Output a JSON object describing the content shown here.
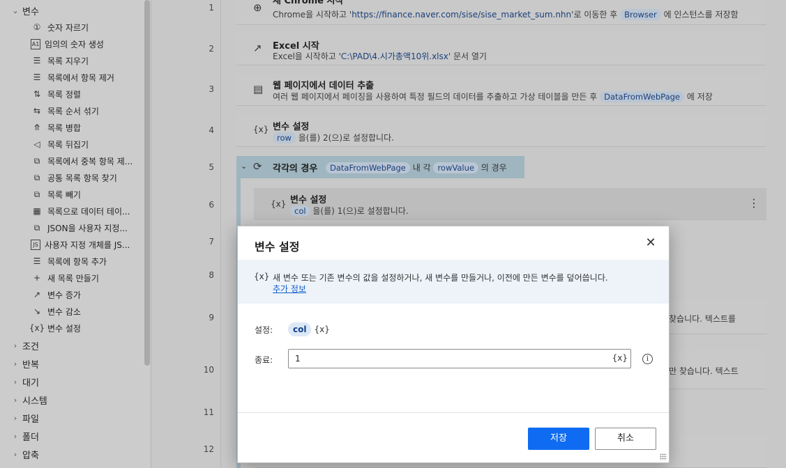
{
  "sidebar": {
    "variables_group": "변수",
    "items": [
      {
        "icon": "number-circle-icon",
        "glyph": "①",
        "label": "숫자 자르기"
      },
      {
        "icon": "random-number-icon",
        "glyph": "A1",
        "label": "임의의 숫자 생성"
      },
      {
        "icon": "clear-list-icon",
        "glyph": "☰",
        "label": "목록 지우기"
      },
      {
        "icon": "remove-list-item-icon",
        "glyph": "☰",
        "label": "목록에서 항목 제거"
      },
      {
        "icon": "sort-list-icon",
        "glyph": "⇅",
        "label": "목록 정렬"
      },
      {
        "icon": "shuffle-list-icon",
        "glyph": "⇆",
        "label": "목록 순서 섞기"
      },
      {
        "icon": "merge-list-icon",
        "glyph": "⤊",
        "label": "목록 병합"
      },
      {
        "icon": "reverse-list-icon",
        "glyph": "◁",
        "label": "목록 뒤집기"
      },
      {
        "icon": "remove-duplicates-icon",
        "glyph": "⧉",
        "label": "목록에서 중복 항목 제..."
      },
      {
        "icon": "common-items-icon",
        "glyph": "⧉",
        "label": "공통 목록 항목 찾기"
      },
      {
        "icon": "subtract-list-icon",
        "glyph": "⧉",
        "label": "목록 빼기"
      },
      {
        "icon": "list-to-datatable-icon",
        "glyph": "▦",
        "label": "목록으로 데이터 테이..."
      },
      {
        "icon": "json-to-object-icon",
        "glyph": "⧉",
        "label": "JSON을 사용자 지정..."
      },
      {
        "icon": "object-to-json-icon",
        "glyph": "JS",
        "label": "사용자 지정 개체를 JS..."
      },
      {
        "icon": "add-to-list-icon",
        "glyph": "☰",
        "label": "목록에 항목 추가"
      },
      {
        "icon": "new-list-icon",
        "glyph": "+",
        "label": "새 목록 만들기"
      },
      {
        "icon": "increase-variable-icon",
        "glyph": "↗",
        "label": "변수 증가"
      },
      {
        "icon": "decrease-variable-icon",
        "glyph": "↘",
        "label": "변수 감소"
      },
      {
        "icon": "set-variable-icon",
        "glyph": "{x}",
        "label": "변수 설정"
      }
    ],
    "groups": [
      "조건",
      "반복",
      "대기",
      "시스템",
      "파일",
      "폴더",
      "압축"
    ]
  },
  "flow": {
    "line_numbers": [
      "1",
      "2",
      "3",
      "4",
      "5",
      "6",
      "7",
      "8",
      "9",
      "10",
      "11",
      "12"
    ],
    "step1": {
      "title": "새 Chrome 시작",
      "desc_a": "Chrome을 시작하고 '",
      "url": "https://finance.naver.com/sise/sise_market_sum.nhn",
      "desc_b": "'로 이동한 후",
      "var": "Browser",
      "desc_c": "에 인스턴스를 저장함"
    },
    "step2": {
      "title": "Excel 시작",
      "desc_a": "Excel을 시작하고 '",
      "path": "C:\\PAD\\4.시가총액10위.xlsx",
      "desc_b": "' 문서 열기"
    },
    "step3": {
      "title": "웹 페이지에서 데이터 추출",
      "desc_a": "여러 웹 페이지에서 페이징을 사용하여 특정 필드의 데이터를 추출하고 가상 테이블을 만든 후",
      "var": "DataFromWebPage",
      "desc_b": "에 저장"
    },
    "step4": {
      "icon_text": "{x}",
      "title": "변수 설정",
      "var": "row",
      "desc_a": "을(를)",
      "value": "2",
      "desc_b": "(으)로 설정합니다."
    },
    "step5": {
      "title": "각각의 경우",
      "var1": "DataFromWebPage",
      "mid": "내 각",
      "var2": "rowValue",
      "end": "의 경우"
    },
    "step6": {
      "icon_text": "{x}",
      "title": "변수 설정",
      "var": "col",
      "desc_a": "을(를)",
      "value": "1",
      "desc_b": "(으)로 설정합니다.",
      "more": "⋮"
    },
    "step9_tail": "찾습니다. 텍스트를",
    "step10_tail": "만 찾습니다. 텍스트"
  },
  "dialog": {
    "title": "변수 설정",
    "close": "✕",
    "info_icon": "{x}",
    "info_text": "새 변수 또는 기존 변수의 값을 설정하거나, 새 변수를 만들거나, 이전에 만든 변수를 덮어씁니다.",
    "info_link": "추가 정보",
    "set_label": "설정:",
    "variable_name": "col",
    "variable_suffix": "{x}",
    "value_label": "종료:",
    "value": "1",
    "value_suffix": "{x}",
    "help": "i",
    "save": "저장",
    "cancel": "취소"
  }
}
